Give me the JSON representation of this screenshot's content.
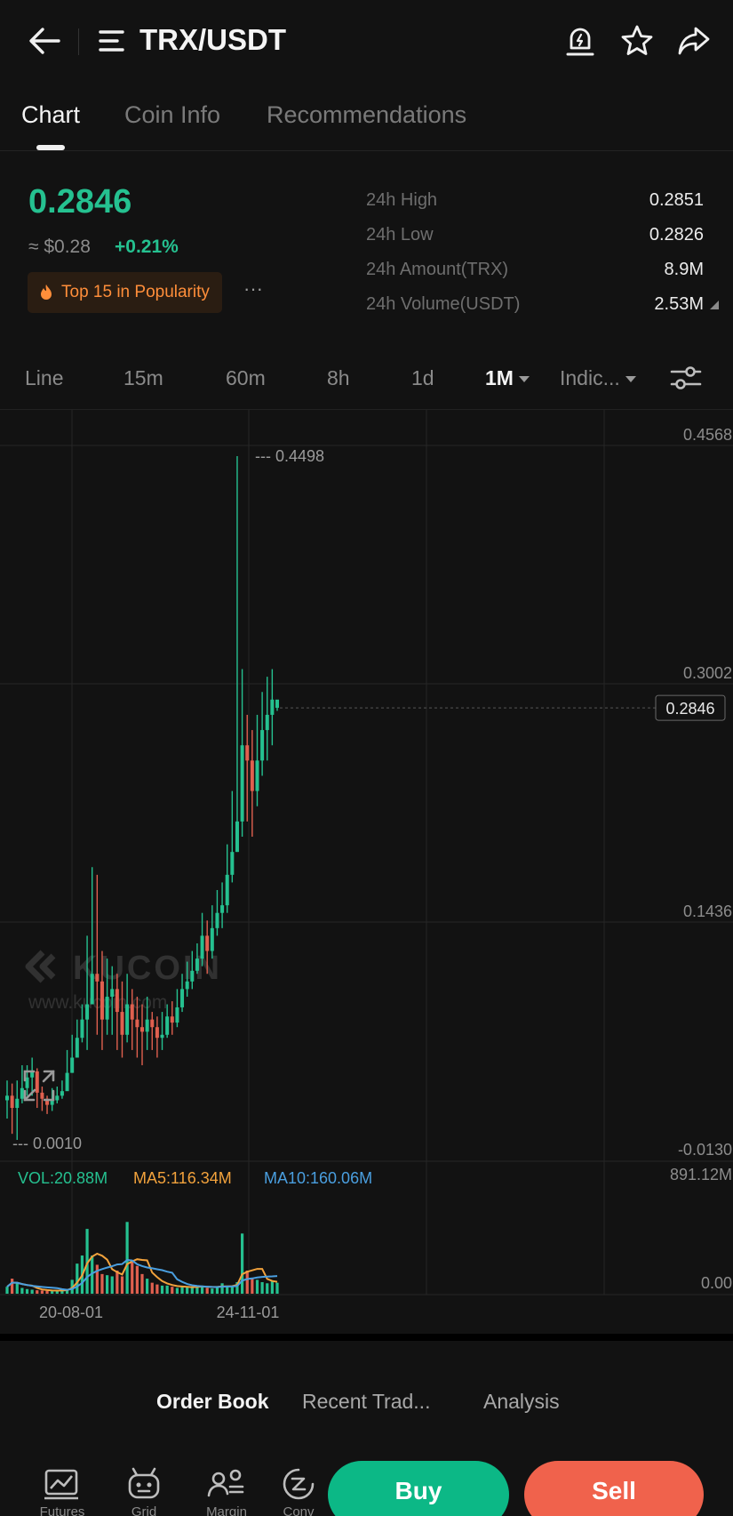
{
  "header": {
    "title": "TRX/USDT",
    "icons": [
      "back-arrow-icon",
      "menu-icon",
      "price-alert-icon",
      "star-icon",
      "share-icon"
    ]
  },
  "tabs": [
    {
      "label": "Chart",
      "active": true
    },
    {
      "label": "Coin Info",
      "active": false
    },
    {
      "label": "Recommendations",
      "active": false
    }
  ],
  "ticker": {
    "price": "0.2846",
    "usd_value": "≈ $0.28",
    "change": "+0.21%",
    "badge": "Top 15 in Popularity",
    "more": "···",
    "stats": [
      {
        "label": "24h High",
        "value": "0.2851"
      },
      {
        "label": "24h Low",
        "value": "0.2826"
      },
      {
        "label": "24h Amount(TRX)",
        "value": "8.9M"
      },
      {
        "label": "24h Volume(USDT)",
        "value": "2.53M"
      }
    ]
  },
  "intervals": {
    "items": [
      "Line",
      "15m",
      "60m",
      "8h",
      "1d",
      "1M",
      "Indic..."
    ],
    "active": "1M"
  },
  "colors": {
    "up": "#25c190",
    "down": "#e0604f",
    "ma5": "#f2a23c",
    "ma10": "#4a9fe0",
    "buy": "#0cb886",
    "sell": "#f0624c",
    "badge_text": "#ff8e3a"
  },
  "chart_data": {
    "type": "candlestick",
    "y_axis_labels": [
      "0.4568",
      "0.3002",
      "0.1436",
      "-0.0130"
    ],
    "ylim": [
      -0.013,
      0.4568
    ],
    "current_price_label": "0.2846",
    "high_marker": "0.4498",
    "low_marker": "0.0010",
    "x_tick_labels": [
      "20-08-01",
      "24-11-01"
    ],
    "watermark": {
      "brand": "KUCOIN",
      "url": "www.kucoin.com"
    },
    "volume": {
      "vol_label": "VOL:20.88M",
      "ma5_label": "MA5:116.34M",
      "ma10_label": "MA10:160.06M",
      "axis_labels": [
        "891.12M",
        "0.00"
      ],
      "ylim": [
        0,
        891.12
      ]
    },
    "close": [
      0.03,
      0.022,
      0.028,
      0.035,
      0.042,
      0.046,
      0.032,
      0.028,
      0.024,
      0.027,
      0.03,
      0.033,
      0.045,
      0.055,
      0.068,
      0.08,
      0.09,
      0.11,
      0.105,
      0.08,
      0.095,
      0.1,
      0.085,
      0.07,
      0.09,
      0.08,
      0.075,
      0.072,
      0.08,
      0.075,
      0.068,
      0.07,
      0.082,
      0.078,
      0.088,
      0.1,
      0.105,
      0.112,
      0.12,
      0.135,
      0.125,
      0.14,
      0.15,
      0.155,
      0.175,
      0.19,
      0.21,
      0.26,
      0.25,
      0.23,
      0.25,
      0.27,
      0.28,
      0.29,
      0.2846
    ],
    "high": [
      0.04,
      0.038,
      0.04,
      0.05,
      0.05,
      0.055,
      0.048,
      0.036,
      0.03,
      0.035,
      0.036,
      0.04,
      0.06,
      0.07,
      0.08,
      0.09,
      0.135,
      0.18,
      0.175,
      0.125,
      0.12,
      0.115,
      0.11,
      0.105,
      0.11,
      0.1,
      0.095,
      0.09,
      0.095,
      0.085,
      0.082,
      0.085,
      0.09,
      0.092,
      0.1,
      0.11,
      0.118,
      0.125,
      0.13,
      0.15,
      0.145,
      0.155,
      0.165,
      0.17,
      0.195,
      0.23,
      0.4498,
      0.31,
      0.28,
      0.27,
      0.28,
      0.295,
      0.305,
      0.31,
      0.2851
    ],
    "low": [
      0.015,
      0.005,
      0.001,
      0.025,
      0.03,
      0.03,
      0.022,
      0.02,
      0.018,
      0.02,
      0.025,
      0.028,
      0.035,
      0.045,
      0.055,
      0.065,
      0.06,
      0.09,
      0.07,
      0.06,
      0.07,
      0.07,
      0.06,
      0.055,
      0.065,
      0.06,
      0.055,
      0.05,
      0.06,
      0.06,
      0.055,
      0.06,
      0.068,
      0.07,
      0.075,
      0.085,
      0.095,
      0.1,
      0.11,
      0.115,
      0.11,
      0.12,
      0.135,
      0.14,
      0.15,
      0.17,
      0.19,
      0.2,
      0.21,
      0.2,
      0.22,
      0.24,
      0.25,
      0.26,
      0.2826
    ],
    "up": [
      1,
      0,
      1,
      1,
      1,
      1,
      0,
      0,
      0,
      1,
      1,
      1,
      1,
      1,
      1,
      1,
      1,
      1,
      0,
      0,
      1,
      1,
      0,
      0,
      1,
      0,
      0,
      0,
      1,
      0,
      0,
      1,
      1,
      0,
      1,
      1,
      1,
      1,
      1,
      1,
      0,
      1,
      1,
      1,
      1,
      1,
      1,
      1,
      0,
      0,
      1,
      1,
      1,
      1,
      1
    ],
    "vol_values": [
      60,
      130,
      95,
      50,
      40,
      35,
      30,
      28,
      25,
      22,
      30,
      35,
      40,
      120,
      260,
      330,
      560,
      330,
      250,
      170,
      160,
      150,
      200,
      150,
      620,
      280,
      240,
      170,
      130,
      95,
      80,
      70,
      70,
      60,
      50,
      60,
      55,
      60,
      65,
      70,
      50,
      45,
      60,
      90,
      70,
      60,
      100,
      520,
      200,
      130,
      120,
      100,
      90,
      110,
      95
    ]
  },
  "bottom_tabs": {
    "items": [
      "Order Book",
      "Recent Trad...",
      "Analysis"
    ],
    "active": "Order Book"
  },
  "bottom_nav": [
    {
      "label": "Futures",
      "icon": "futures-chart-icon"
    },
    {
      "label": "Grid",
      "icon": "grid-bot-icon"
    },
    {
      "label": "Margin",
      "icon": "margin-icon"
    },
    {
      "label": "Conv",
      "icon": "convert-icon"
    }
  ],
  "actions": {
    "buy": "Buy",
    "sell": "Sell"
  }
}
